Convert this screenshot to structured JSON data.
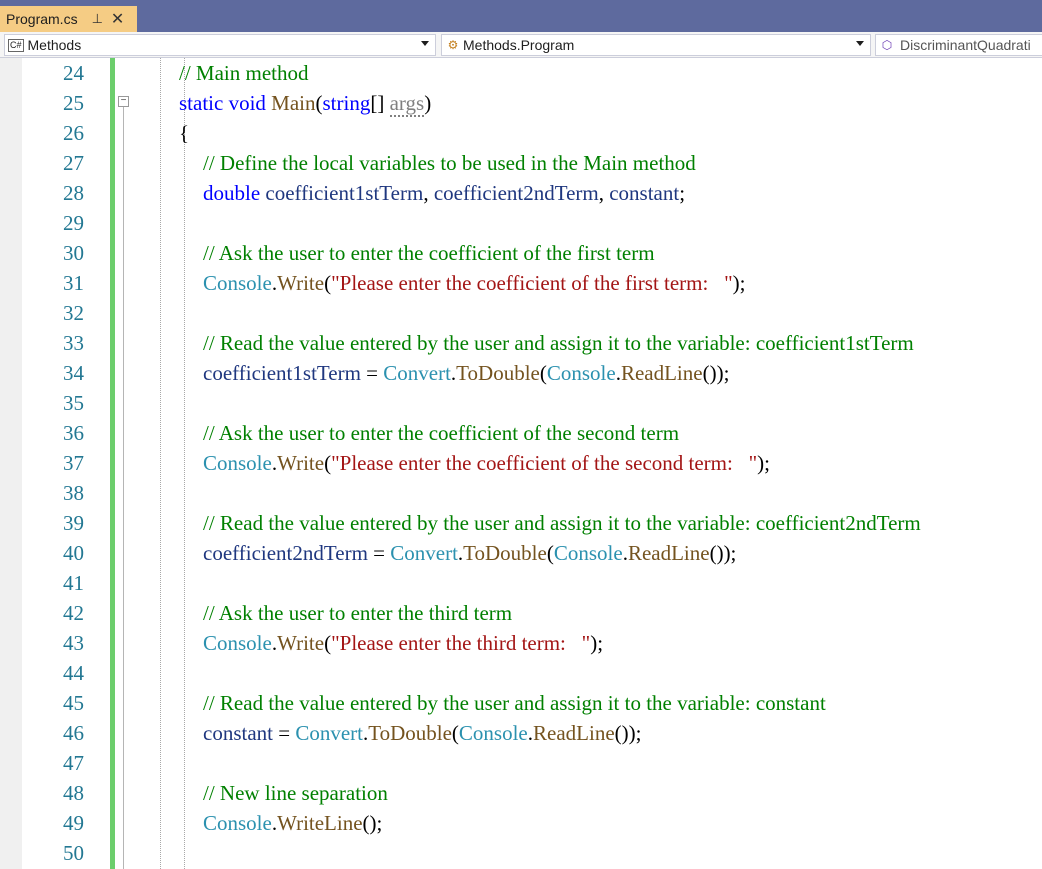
{
  "tab": {
    "title": "Program.cs",
    "pin_glyph": "⊥",
    "close_glyph": "✕"
  },
  "nav": {
    "project": {
      "badge": "C#",
      "label": "Methods"
    },
    "type": {
      "label": "Methods.Program"
    },
    "member": {
      "label": "DiscriminantQuadrati"
    }
  },
  "editor": {
    "fold_glyph": "−",
    "lines": [
      {
        "num": "24",
        "indent": 1,
        "tokens": [
          {
            "t": "cm",
            "v": "// Main method"
          }
        ]
      },
      {
        "num": "25",
        "indent": 1,
        "tokens": [
          {
            "t": "kw",
            "v": "static"
          },
          {
            "t": "pu",
            "v": " "
          },
          {
            "t": "kw",
            "v": "void"
          },
          {
            "t": "pu",
            "v": " "
          },
          {
            "t": "fn",
            "v": "Main"
          },
          {
            "t": "pu",
            "v": "("
          },
          {
            "t": "kw",
            "v": "string"
          },
          {
            "t": "pu",
            "v": "[] "
          },
          {
            "t": "un",
            "v": "args"
          },
          {
            "t": "pu",
            "v": ")"
          }
        ]
      },
      {
        "num": "26",
        "indent": 1,
        "tokens": [
          {
            "t": "pu",
            "v": "{"
          }
        ]
      },
      {
        "num": "27",
        "indent": 2,
        "tokens": [
          {
            "t": "cm",
            "v": "// Define the local variables to be used in the Main method"
          }
        ]
      },
      {
        "num": "28",
        "indent": 2,
        "tokens": [
          {
            "t": "kw",
            "v": "double"
          },
          {
            "t": "pu",
            "v": " "
          },
          {
            "t": "vr",
            "v": "coefficient1stTerm"
          },
          {
            "t": "pu",
            "v": ", "
          },
          {
            "t": "vr",
            "v": "coefficient2ndTerm"
          },
          {
            "t": "pu",
            "v": ", "
          },
          {
            "t": "vr",
            "v": "constant"
          },
          {
            "t": "pu",
            "v": ";"
          }
        ]
      },
      {
        "num": "29",
        "indent": 2,
        "tokens": []
      },
      {
        "num": "30",
        "indent": 2,
        "tokens": [
          {
            "t": "cm",
            "v": "// Ask the user to enter the coefficient of the first term"
          }
        ]
      },
      {
        "num": "31",
        "indent": 2,
        "tokens": [
          {
            "t": "ty",
            "v": "Console"
          },
          {
            "t": "pu",
            "v": "."
          },
          {
            "t": "fn",
            "v": "Write"
          },
          {
            "t": "pu",
            "v": "("
          },
          {
            "t": "st",
            "v": "\"Please enter the coefficient of the first term:   \""
          },
          {
            "t": "pu",
            "v": ");"
          }
        ]
      },
      {
        "num": "32",
        "indent": 2,
        "tokens": []
      },
      {
        "num": "33",
        "indent": 2,
        "tokens": [
          {
            "t": "cm",
            "v": "// Read the value entered by the user and assign it to the variable: coefficient1stTerm"
          }
        ]
      },
      {
        "num": "34",
        "indent": 2,
        "tokens": [
          {
            "t": "vr",
            "v": "coefficient1stTerm"
          },
          {
            "t": "pu",
            "v": " = "
          },
          {
            "t": "ty",
            "v": "Convert"
          },
          {
            "t": "pu",
            "v": "."
          },
          {
            "t": "fn",
            "v": "ToDouble"
          },
          {
            "t": "pu",
            "v": "("
          },
          {
            "t": "ty",
            "v": "Console"
          },
          {
            "t": "pu",
            "v": "."
          },
          {
            "t": "fn",
            "v": "ReadLine"
          },
          {
            "t": "pu",
            "v": "());"
          }
        ]
      },
      {
        "num": "35",
        "indent": 2,
        "tokens": []
      },
      {
        "num": "36",
        "indent": 2,
        "tokens": [
          {
            "t": "cm",
            "v": "// Ask the user to enter the coefficient of the second term"
          }
        ]
      },
      {
        "num": "37",
        "indent": 2,
        "tokens": [
          {
            "t": "ty",
            "v": "Console"
          },
          {
            "t": "pu",
            "v": "."
          },
          {
            "t": "fn",
            "v": "Write"
          },
          {
            "t": "pu",
            "v": "("
          },
          {
            "t": "st",
            "v": "\"Please enter the coefficient of the second term:   \""
          },
          {
            "t": "pu",
            "v": ");"
          }
        ]
      },
      {
        "num": "38",
        "indent": 2,
        "tokens": []
      },
      {
        "num": "39",
        "indent": 2,
        "tokens": [
          {
            "t": "cm",
            "v": "// Read the value entered by the user and assign it to the variable: coefficient2ndTerm"
          }
        ]
      },
      {
        "num": "40",
        "indent": 2,
        "tokens": [
          {
            "t": "vr",
            "v": "coefficient2ndTerm"
          },
          {
            "t": "pu",
            "v": " = "
          },
          {
            "t": "ty",
            "v": "Convert"
          },
          {
            "t": "pu",
            "v": "."
          },
          {
            "t": "fn",
            "v": "ToDouble"
          },
          {
            "t": "pu",
            "v": "("
          },
          {
            "t": "ty",
            "v": "Console"
          },
          {
            "t": "pu",
            "v": "."
          },
          {
            "t": "fn",
            "v": "ReadLine"
          },
          {
            "t": "pu",
            "v": "());"
          }
        ]
      },
      {
        "num": "41",
        "indent": 2,
        "tokens": []
      },
      {
        "num": "42",
        "indent": 2,
        "tokens": [
          {
            "t": "cm",
            "v": "// Ask the user to enter the third term"
          }
        ]
      },
      {
        "num": "43",
        "indent": 2,
        "tokens": [
          {
            "t": "ty",
            "v": "Console"
          },
          {
            "t": "pu",
            "v": "."
          },
          {
            "t": "fn",
            "v": "Write"
          },
          {
            "t": "pu",
            "v": "("
          },
          {
            "t": "st",
            "v": "\"Please enter the third term:   \""
          },
          {
            "t": "pu",
            "v": ");"
          }
        ]
      },
      {
        "num": "44",
        "indent": 2,
        "tokens": []
      },
      {
        "num": "45",
        "indent": 2,
        "tokens": [
          {
            "t": "cm",
            "v": "// Read the value entered by the user and assign it to the variable: constant"
          }
        ]
      },
      {
        "num": "46",
        "indent": 2,
        "tokens": [
          {
            "t": "vr",
            "v": "constant"
          },
          {
            "t": "pu",
            "v": " = "
          },
          {
            "t": "ty",
            "v": "Convert"
          },
          {
            "t": "pu",
            "v": "."
          },
          {
            "t": "fn",
            "v": "ToDouble"
          },
          {
            "t": "pu",
            "v": "("
          },
          {
            "t": "ty",
            "v": "Console"
          },
          {
            "t": "pu",
            "v": "."
          },
          {
            "t": "fn",
            "v": "ReadLine"
          },
          {
            "t": "pu",
            "v": "());"
          }
        ]
      },
      {
        "num": "47",
        "indent": 2,
        "tokens": []
      },
      {
        "num": "48",
        "indent": 2,
        "tokens": [
          {
            "t": "cm",
            "v": "// New line separation"
          }
        ]
      },
      {
        "num": "49",
        "indent": 2,
        "tokens": [
          {
            "t": "ty",
            "v": "Console"
          },
          {
            "t": "pu",
            "v": "."
          },
          {
            "t": "fn",
            "v": "WriteLine"
          },
          {
            "t": "pu",
            "v": "();"
          }
        ]
      },
      {
        "num": "50",
        "indent": 2,
        "tokens": []
      }
    ]
  },
  "colors": {
    "comment": "#008000",
    "keyword": "#0000ff",
    "type": "#2b91af",
    "method": "#74531f",
    "string": "#a31515",
    "variable": "#1f377f",
    "line_number": "#237893",
    "change_margin": "#6cce6c",
    "active_tab": "#f5cc84",
    "titlebar": "#5e6a9e"
  }
}
